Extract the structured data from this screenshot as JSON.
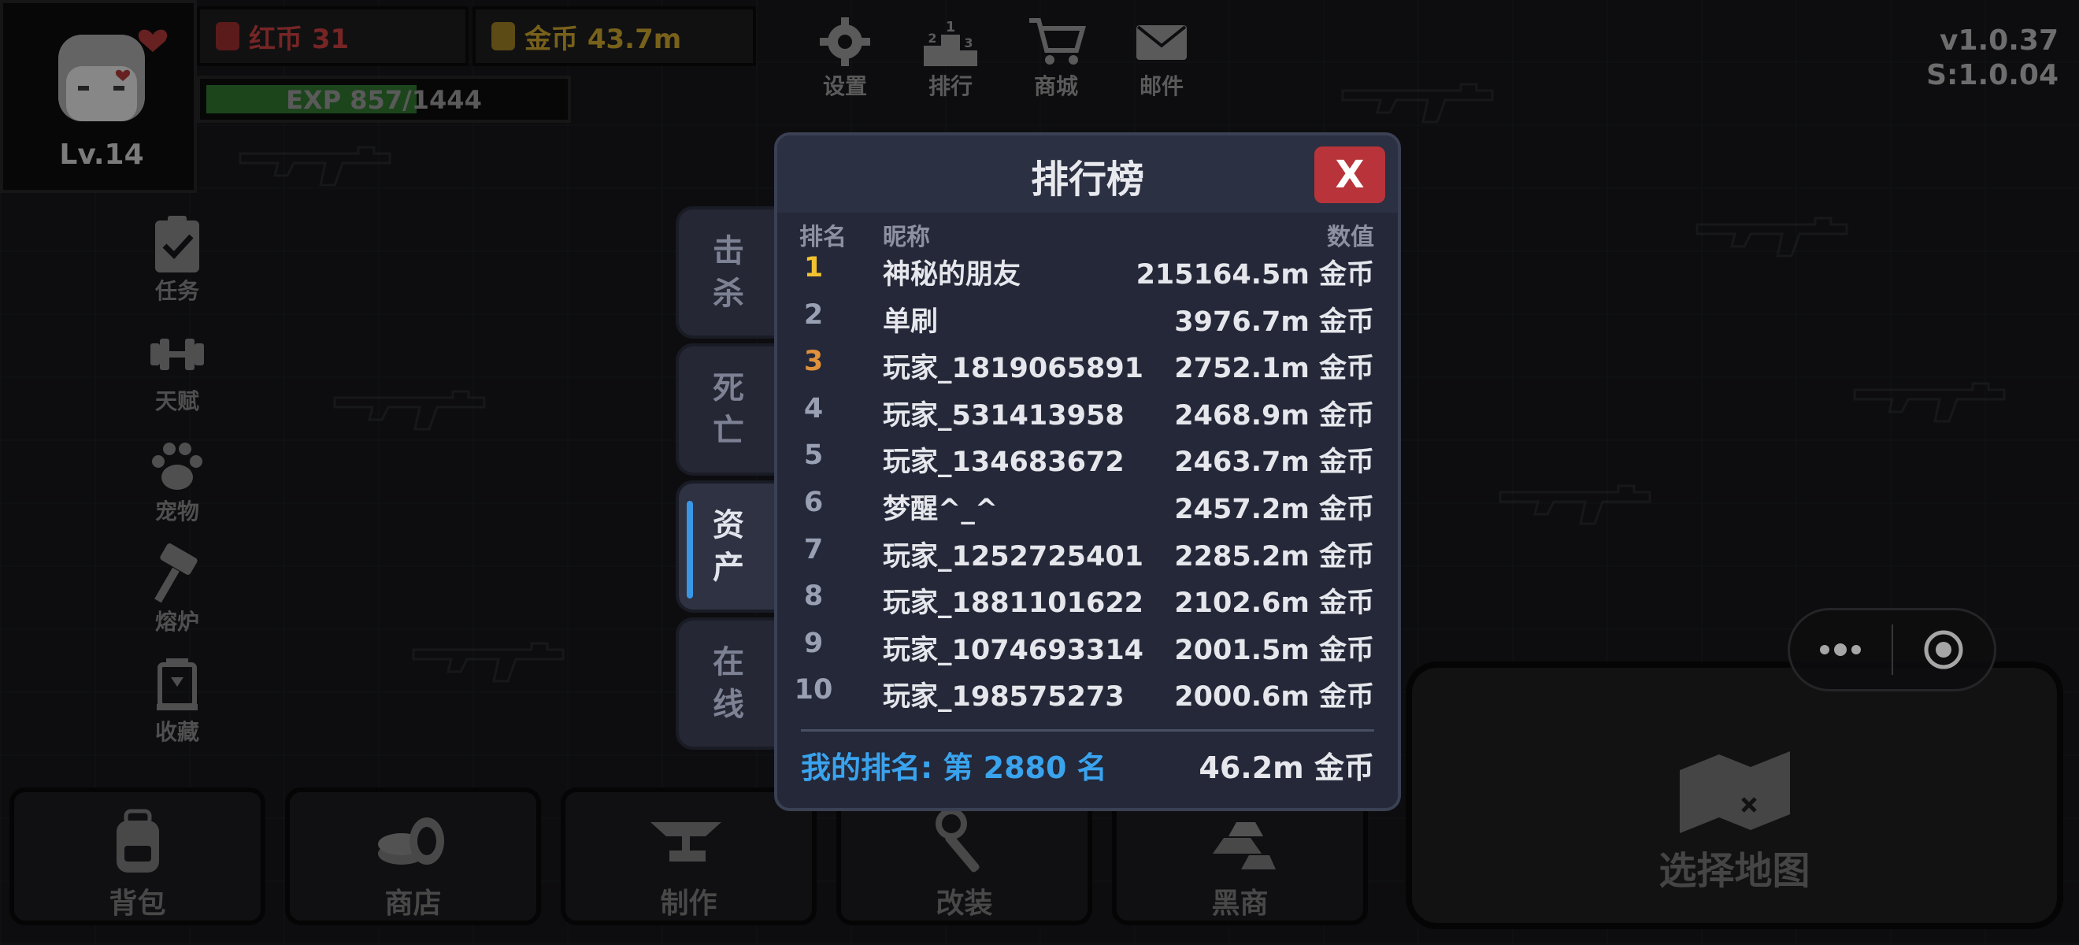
{
  "player": {
    "level": "Lv.14",
    "red_coins": "红币 31",
    "gold_coins": "金币 43.7m",
    "exp_text": "EXP 857/1444",
    "exp_progress": 0.59
  },
  "top_menu": [
    {
      "label": "设置",
      "icon": "gear-icon"
    },
    {
      "label": "排行",
      "icon": "podium-icon"
    },
    {
      "label": "商城",
      "icon": "cart-icon"
    },
    {
      "label": "邮件",
      "icon": "mail-icon"
    }
  ],
  "version": {
    "client": "v1.0.37",
    "server": "S:1.0.04"
  },
  "side_menu": [
    {
      "label": "任务",
      "icon": "clipboard-icon"
    },
    {
      "label": "天赋",
      "icon": "dumbbell-icon"
    },
    {
      "label": "宠物",
      "icon": "paw-icon"
    },
    {
      "label": "熔炉",
      "icon": "hammer-icon"
    },
    {
      "label": "收藏",
      "icon": "trophy-case-icon"
    }
  ],
  "bottom_menu": [
    {
      "label": "背包",
      "icon": "backpack-icon"
    },
    {
      "label": "商店",
      "icon": "coins-icon"
    },
    {
      "label": "制作",
      "icon": "anvil-icon"
    },
    {
      "label": "改装",
      "icon": "wrench-icon"
    },
    {
      "label": "黑商",
      "icon": "gold-bars-icon"
    }
  ],
  "map_button": {
    "label": "选择地图",
    "icon": "map-icon"
  },
  "leaderboard": {
    "title": "排行榜",
    "close_label": "X",
    "tabs": [
      "击杀",
      "死亡",
      "资产",
      "在线"
    ],
    "active_tab": "资产",
    "columns": {
      "rank": "排名",
      "name": "昵称",
      "value": "数值"
    },
    "rows": [
      {
        "rank": "1",
        "name": "神秘的朋友",
        "value": "215164.5m 金币"
      },
      {
        "rank": "2",
        "name": "单刷",
        "value": "3976.7m 金币"
      },
      {
        "rank": "3",
        "name": "玩家_1819065891",
        "value": "2752.1m 金币"
      },
      {
        "rank": "4",
        "name": "玩家_531413958",
        "value": "2468.9m 金币"
      },
      {
        "rank": "5",
        "name": "玩家_134683672",
        "value": "2463.7m 金币"
      },
      {
        "rank": "6",
        "name": "梦醒^_^",
        "value": "2457.2m 金币"
      },
      {
        "rank": "7",
        "name": "玩家_1252725401",
        "value": "2285.2m 金币"
      },
      {
        "rank": "8",
        "name": "玩家_1881101622",
        "value": "2102.6m 金币"
      },
      {
        "rank": "9",
        "name": "玩家_1074693314",
        "value": "2001.5m 金币"
      },
      {
        "rank": "10",
        "name": "玩家_198575273",
        "value": "2000.6m 金币"
      }
    ],
    "my_rank_text": "我的排名: 第 2880 名",
    "my_value": "46.2m 金币",
    "colors": {
      "gold": "#f2c230",
      "bronze": "#e0913a",
      "accent": "#3aa3ee",
      "close": "#b8343a"
    }
  }
}
